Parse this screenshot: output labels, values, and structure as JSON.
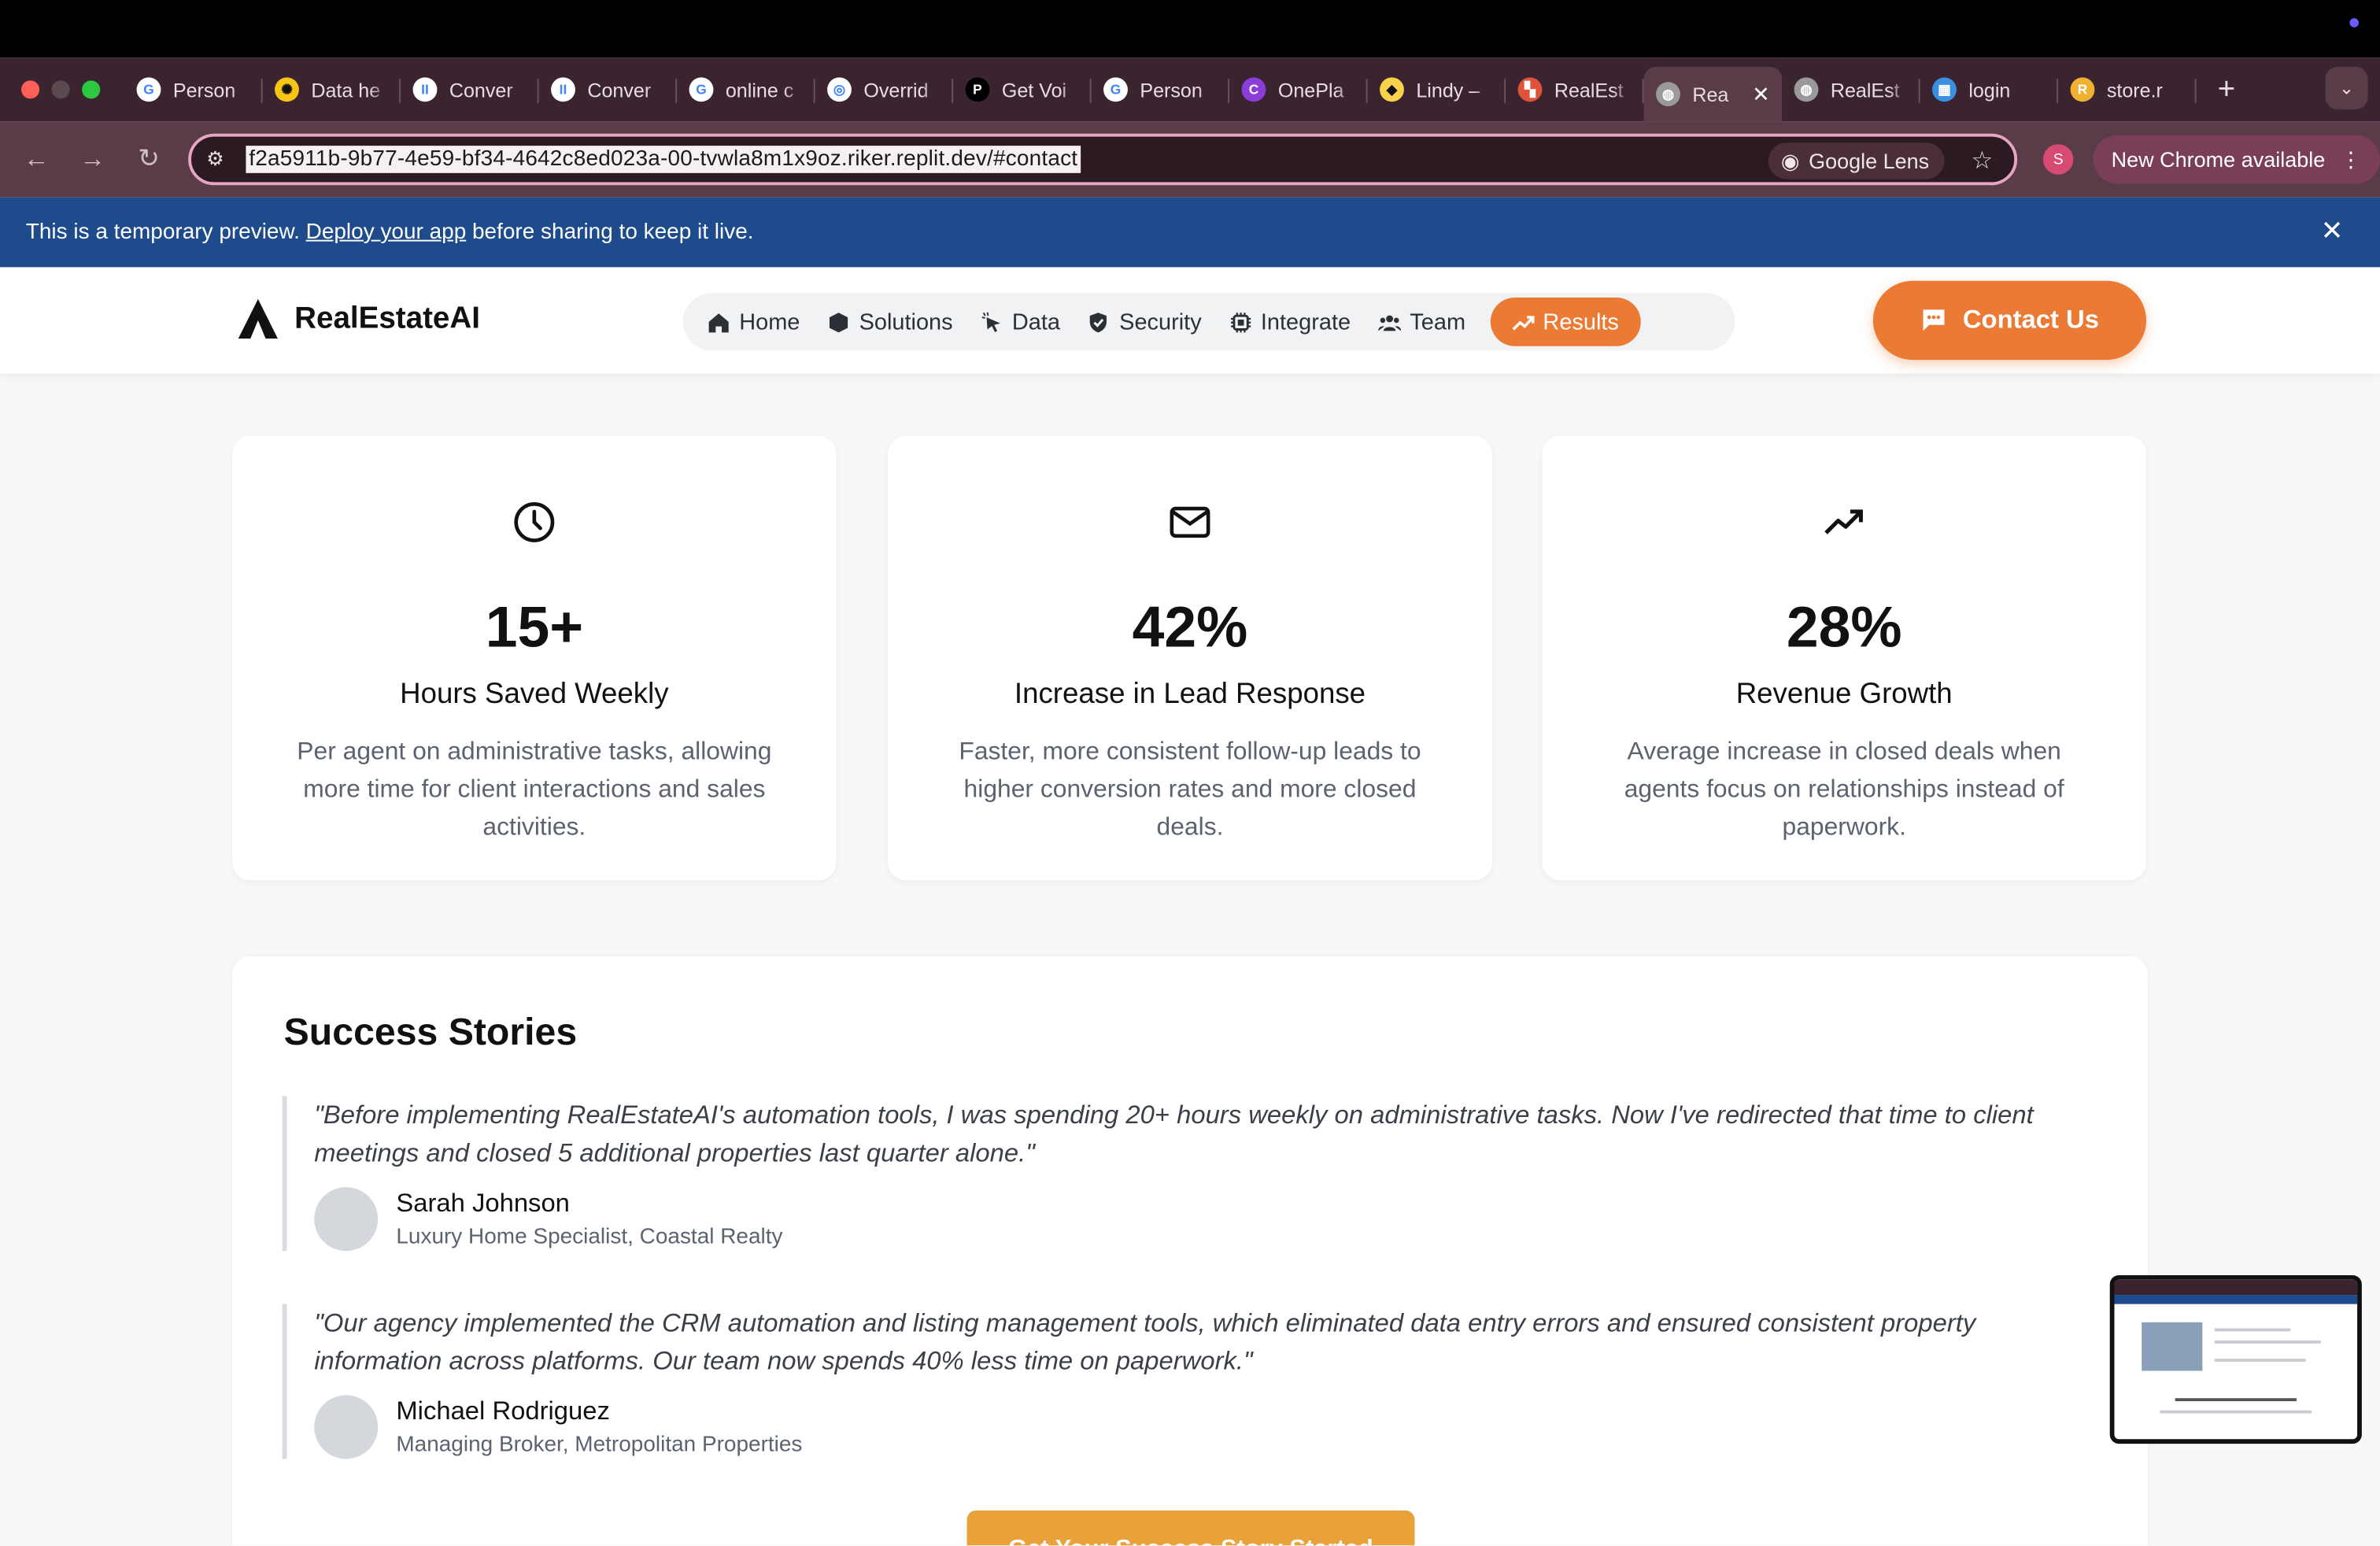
{
  "browser": {
    "tabs": [
      {
        "title": "Person",
        "fav_color": "#ffffff",
        "fav_text": "G"
      },
      {
        "title": "Data he",
        "fav_color": "#f5c518",
        "fav_text": "✺"
      },
      {
        "title": "Conver",
        "fav_color": "#ffffff",
        "fav_text": "II"
      },
      {
        "title": "Conver",
        "fav_color": "#ffffff",
        "fav_text": "II"
      },
      {
        "title": "online c",
        "fav_color": "#ffffff",
        "fav_text": "G"
      },
      {
        "title": "Overrid",
        "fav_color": "#ffffff",
        "fav_text": "◎"
      },
      {
        "title": "Get Voi",
        "fav_color": "#000000",
        "fav_text": "P"
      },
      {
        "title": "Person",
        "fav_color": "#ffffff",
        "fav_text": "G"
      },
      {
        "title": "OnePla",
        "fav_color": "#8b3dd8",
        "fav_text": "C"
      },
      {
        "title": "Lindy –",
        "fav_color": "#f7d24a",
        "fav_text": "◆"
      },
      {
        "title": "RealEst",
        "fav_color": "#e0533a",
        "fav_text": "▚"
      },
      {
        "title": "Rea",
        "fav_color": "#9a9a9a",
        "fav_text": "◍",
        "active": true
      },
      {
        "title": "RealEst",
        "fav_color": "#9a9a9a",
        "fav_text": "◍"
      },
      {
        "title": "login",
        "fav_color": "#3a8fe0",
        "fav_text": "▦"
      },
      {
        "title": "store.r",
        "fav_color": "#f0b030",
        "fav_text": "R"
      }
    ],
    "url": "f2a5911b-9b77-4e59-bf34-4642c8ed023a-00-tvwla8m1x9oz.riker.replit.dev/#contact",
    "lens_label": "Google Lens",
    "profile_initial": "S",
    "update_label": "New Chrome available"
  },
  "banner": {
    "text_before": "This is a temporary preview.",
    "link": "Deploy your app",
    "text_after": "before sharing to keep it live."
  },
  "site": {
    "brand": "RealEstateAI",
    "nav": [
      {
        "label": "Home",
        "icon": "home-icon"
      },
      {
        "label": "Solutions",
        "icon": "cube-icon"
      },
      {
        "label": "Data",
        "icon": "pointer-icon"
      },
      {
        "label": "Security",
        "icon": "shield-icon"
      },
      {
        "label": "Integrate",
        "icon": "chip-icon"
      },
      {
        "label": "Team",
        "icon": "users-icon"
      },
      {
        "label": "Results",
        "icon": "trend-icon",
        "active": true
      }
    ],
    "contact_label": "Contact Us",
    "accent": "#ea7a34"
  },
  "stats": [
    {
      "icon": "clock-icon",
      "value": "15+",
      "title": "Hours Saved Weekly",
      "desc": "Per agent on administrative tasks, allowing more time for client interactions and sales activities."
    },
    {
      "icon": "mail-icon",
      "value": "42%",
      "title": "Increase in Lead Response",
      "desc": "Faster, more consistent follow-up leads to higher conversion rates and more closed deals."
    },
    {
      "icon": "trending-up-icon",
      "value": "28%",
      "title": "Revenue Growth",
      "desc": "Average increase in closed deals when agents focus on relationships instead of paperwork."
    }
  ],
  "stories": {
    "heading": "Success Stories",
    "items": [
      {
        "quote": "\"Before implementing RealEstateAI's automation tools, I was spending 20+ hours weekly on administrative tasks. Now I've redirected that time to client meetings and closed 5 additional properties last quarter alone.\"",
        "name": "Sarah Johnson",
        "role": "Luxury Home Specialist, Coastal Realty"
      },
      {
        "quote": "\"Our agency implemented the CRM automation and listing management tools, which eliminated data entry errors and ensured consistent property information across platforms. Our team now spends 40% less time on paperwork.\"",
        "name": "Michael Rodriguez",
        "role": "Managing Broker, Metropolitan Properties"
      }
    ],
    "cta_label": "Get Your Success Story Started"
  }
}
